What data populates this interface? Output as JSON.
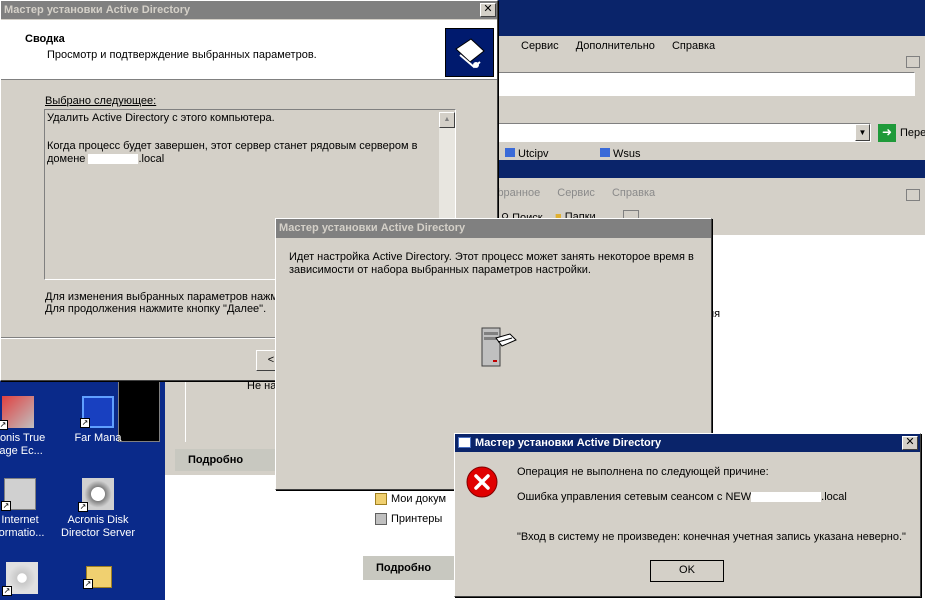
{
  "colors": {
    "desktop": "#0a2a8a",
    "active_title": "#0a246a",
    "inactive_title": "#808080",
    "face": "#d4d0c8"
  },
  "explorer1": {
    "menu": [
      "Сервис",
      "Дополнительно",
      "Справка"
    ],
    "go_label": "Пере",
    "links": [
      "Utcipv",
      "Wsus"
    ]
  },
  "explorer2": {
    "menu": [
      "ibранное",
      "Сервис",
      "Справка"
    ],
    "toolbar": [
      "Поиск",
      "Папки"
    ],
    "side_text_1": "ия",
    "side_text_2": "Не на",
    "details_label": "Подробно",
    "details_label_2": "Подробно",
    "items": [
      "Мои докум",
      "Принтеры"
    ]
  },
  "wizard_summary": {
    "title": "Мастер установки Active Directory",
    "header_title": "Сводка",
    "header_subtitle": "Просмотр и подтверждение выбранных параметров.",
    "selected_label": "Выбрано следующее:",
    "summary_line1": "Удалить Active Directory с этого компьютера.",
    "summary_line2a": "Когда процесс будет завершен, этот сервер станет рядовым сервером в",
    "summary_line2b_prefix": "домене",
    "summary_line2b_suffix": ".local",
    "footer_line1": "Для изменения выбранных параметров нажм",
    "footer_line2": "Для продолжения нажмите кнопку \"Далее\".",
    "back_button": "<"
  },
  "wizard_progress": {
    "title": "Мастер установки Active Directory",
    "message_line1": "Идет настройка Active Directory.  Этот процесс может занять некоторое время в",
    "message_line2": "зависимости от набора выбранных параметров настройки."
  },
  "error_dialog": {
    "title": "Мастер установки Active Directory",
    "line1": "Операция не выполнена по следующей причине:",
    "line2_prefix": "Ошибка управления сетевым сеансом с NEW",
    "line2_suffix": ".local",
    "line3": "\"Вход в систему не произведен: конечная учетная запись указана неверно.\"",
    "ok_button": "OK"
  },
  "desktop_icons": [
    {
      "line1": "cronis True",
      "line2": "nage Ec..."
    },
    {
      "line1": "Far Mana",
      "line2": ""
    },
    {
      "line1": "Internet",
      "line2": "formatio..."
    },
    {
      "line1": "Acronis Disk",
      "line2": "Director Server"
    }
  ]
}
